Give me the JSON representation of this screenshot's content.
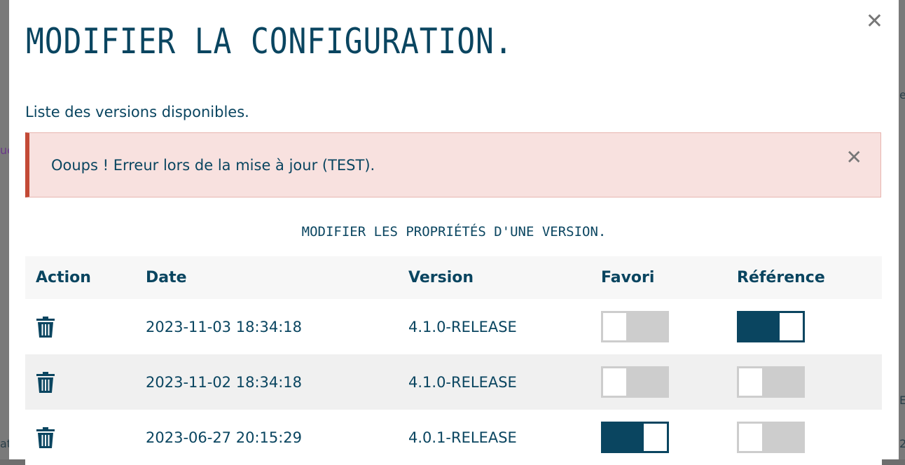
{
  "background": {
    "fragments": [
      "ue",
      "at",
      "et",
      "EA",
      "2"
    ]
  },
  "modal": {
    "title": "MODIFIER LA CONFIGURATION.",
    "close_icon": "close-icon",
    "subtitle": "Liste des versions disponibles.",
    "alert": {
      "message": "Ooups ! Erreur lors de la mise à jour (TEST).",
      "close_icon": "close-icon",
      "color": "#c34a36"
    },
    "section_title": "MODIFIER LES PROPRIÉTÉS D'UNE VERSION.",
    "table": {
      "headers": {
        "action": "Action",
        "date": "Date",
        "version": "Version",
        "favori": "Favori",
        "reference": "Référence"
      },
      "rows": [
        {
          "date": "2023-11-03 18:34:18",
          "version": "4.1.0-RELEASE",
          "favori": false,
          "reference": true
        },
        {
          "date": "2023-11-02 18:34:18",
          "version": "4.1.0-RELEASE",
          "favori": false,
          "reference": false
        },
        {
          "date": "2023-06-27 20:15:29",
          "version": "4.0.1-RELEASE",
          "favori": true,
          "reference": false
        }
      ]
    }
  },
  "colors": {
    "primary": "#0a4560",
    "toggle_off": "#cdcdcd",
    "alert_bg": "#f8e1df"
  }
}
